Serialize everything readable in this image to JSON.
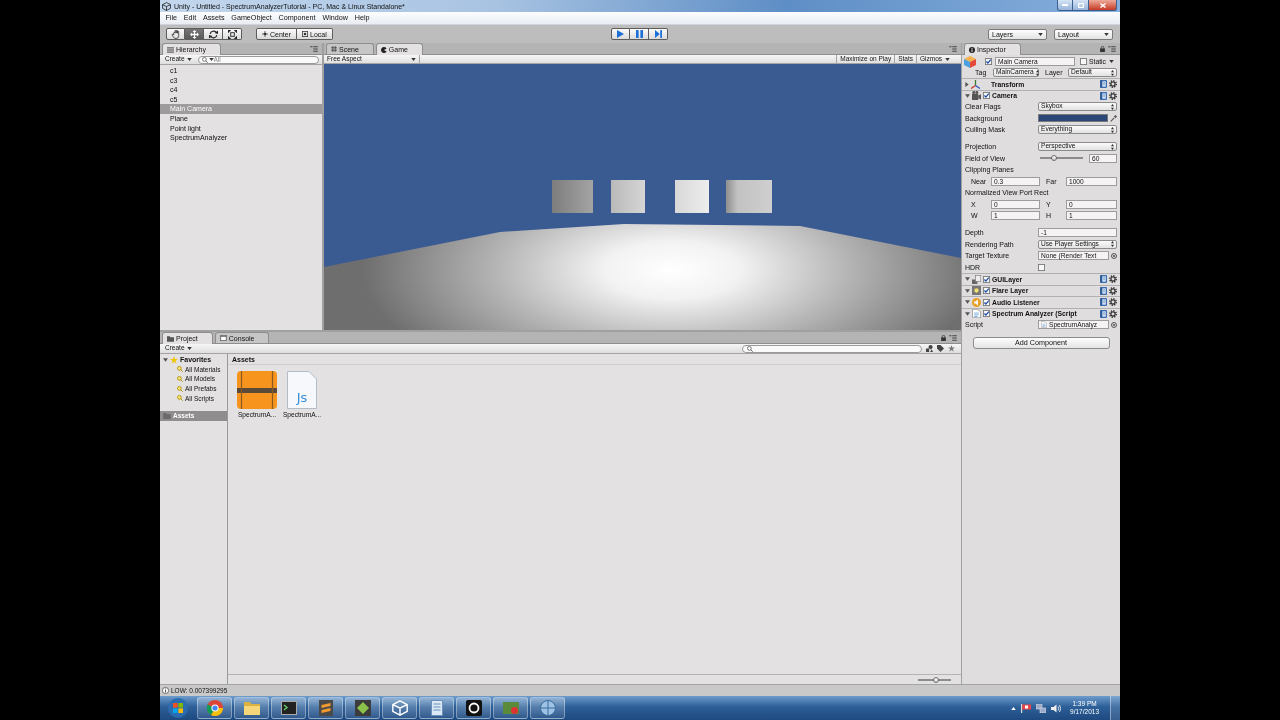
{
  "window": {
    "title": "Unity - Untitled - SpectrumAnalyzerTutorial - PC, Mac & Linux Standalone*"
  },
  "menu": [
    "File",
    "Edit",
    "Assets",
    "GameObject",
    "Component",
    "Window",
    "Help"
  ],
  "toolbar": {
    "tools": [
      {
        "kind": "hand",
        "selected": false
      },
      {
        "kind": "move",
        "selected": true
      },
      {
        "kind": "rotate",
        "selected": false
      },
      {
        "kind": "scale",
        "selected": false
      }
    ],
    "pivot": [
      {
        "kind": "center",
        "label": "Center"
      },
      {
        "kind": "local",
        "label": "Local"
      }
    ],
    "playback": [
      {
        "kind": "play"
      },
      {
        "kind": "pause"
      },
      {
        "kind": "step"
      }
    ],
    "dropdowns": [
      "Layers",
      "Layout"
    ]
  },
  "hierarchy": {
    "tab": "Hierarchy",
    "create": "Create",
    "search": {
      "placeholder": "All"
    },
    "items": [
      {
        "label": "c1",
        "selected": false
      },
      {
        "label": "c3",
        "selected": false
      },
      {
        "label": "c4",
        "selected": false
      },
      {
        "label": "c5",
        "selected": false
      },
      {
        "label": "Main Camera",
        "selected": true
      },
      {
        "label": "Plane",
        "selected": false
      },
      {
        "label": "Point light",
        "selected": false
      },
      {
        "label": "SpectrumAnalyzer",
        "selected": false
      }
    ]
  },
  "view": {
    "tabs": [
      {
        "kind": "scene",
        "label": "Scene",
        "selected": false
      },
      {
        "kind": "game",
        "label": "Game",
        "selected": true
      }
    ],
    "aspect": "Free Aspect",
    "options": [
      {
        "kind": "toggle",
        "label": "Maximize on Play",
        "on": false
      },
      {
        "kind": "toggle",
        "label": "Stats",
        "on": false
      },
      {
        "kind": "dropdown",
        "label": "Gizmos",
        "on": false
      }
    ]
  },
  "inspector": {
    "tab": "Inspector",
    "object": {
      "name": "Main Camera",
      "active": true,
      "static_label": "Static",
      "static": false,
      "tag_label": "Tag",
      "tag": "MainCamera",
      "layer_label": "Layer",
      "layer": "Default"
    },
    "components": [
      {
        "kind": "transform",
        "name": "Transform",
        "expanded": false
      },
      {
        "kind": "camera",
        "name": "Camera",
        "expanded": true,
        "enabled": true,
        "sections": [
          [
            {
              "kind": "dropdown",
              "label": "Clear Flags",
              "value": "Skybox"
            },
            {
              "kind": "color",
              "label": "Background",
              "color": "#2b4778"
            },
            {
              "kind": "dropdown",
              "label": "Culling Mask",
              "value": "Everything"
            }
          ],
          [
            {
              "kind": "dropdown",
              "label": "Projection",
              "value": "Perspective"
            },
            {
              "kind": "slider",
              "label": "Field of View",
              "level": 0.33,
              "value": "60"
            },
            {
              "kind": "heading",
              "label": "Clipping Planes"
            },
            {
              "kind": "pair",
              "fields": [
                {
                  "label": "Near",
                  "value": "0.3"
                },
                {
                  "label": "Far",
                  "value": "1000"
                }
              ]
            },
            {
              "kind": "heading",
              "label": "Normalized View Port Rect"
            },
            {
              "kind": "pair",
              "fields": [
                {
                  "label": "X",
                  "value": "0"
                },
                {
                  "label": "Y",
                  "value": "0"
                }
              ]
            },
            {
              "kind": "pair",
              "fields": [
                {
                  "label": "W",
                  "value": "1"
                },
                {
                  "label": "H",
                  "value": "1"
                }
              ]
            }
          ],
          [
            {
              "kind": "text",
              "label": "Depth",
              "value": "-1"
            },
            {
              "kind": "dropdown",
              "label": "Rendering Path",
              "value": "Use Player Settings"
            },
            {
              "kind": "object",
              "label": "Target Texture",
              "value": "None (Render Text"
            },
            {
              "kind": "checkbox",
              "label": "HDR",
              "checked": false
            }
          ]
        ]
      },
      {
        "kind": "guilayer",
        "name": "GUILayer",
        "expanded": true,
        "enabled": true
      },
      {
        "kind": "flare",
        "name": "Flare Layer",
        "expanded": true,
        "enabled": true
      },
      {
        "kind": "audio",
        "name": "Audio Listener",
        "expanded": true,
        "enabled": true
      },
      {
        "kind": "script",
        "name": "Spectrum Analyzer (Script",
        "expanded": true,
        "enabled": true,
        "sections": [
          [
            {
              "kind": "script",
              "label": "Script",
              "value": "SpectrumAnalyz"
            }
          ]
        ]
      }
    ],
    "add_component": "Add Component"
  },
  "project": {
    "tabs": [
      {
        "kind": "project",
        "label": "Project",
        "selected": true
      },
      {
        "kind": "console",
        "label": "Console",
        "selected": false
      }
    ],
    "create": "Create",
    "tree": [
      {
        "kind": "favorites",
        "label": "Favorites",
        "expanded": true,
        "selected": false,
        "children": [
          {
            "kind": "search",
            "label": "All Materials",
            "selected": false
          },
          {
            "kind": "search",
            "label": "All Models",
            "selected": false
          },
          {
            "kind": "search",
            "label": "All Prefabs",
            "selected": false
          },
          {
            "kind": "search",
            "label": "All Scripts",
            "selected": false
          }
        ]
      },
      {
        "kind": "folder",
        "label": "Assets",
        "selected": true
      }
    ],
    "path": "Assets",
    "assets": [
      {
        "kind": "audio",
        "name": "SpectrumA..."
      },
      {
        "kind": "script",
        "name": "SpectrumA...",
        "badge": "Js"
      }
    ],
    "icon_size": {
      "level": 0.55
    }
  },
  "status_bar": {
    "message": "LOW: 0.007399295"
  },
  "taskbar": {
    "time": "1:39 PM",
    "date": "9/17/2013"
  }
}
